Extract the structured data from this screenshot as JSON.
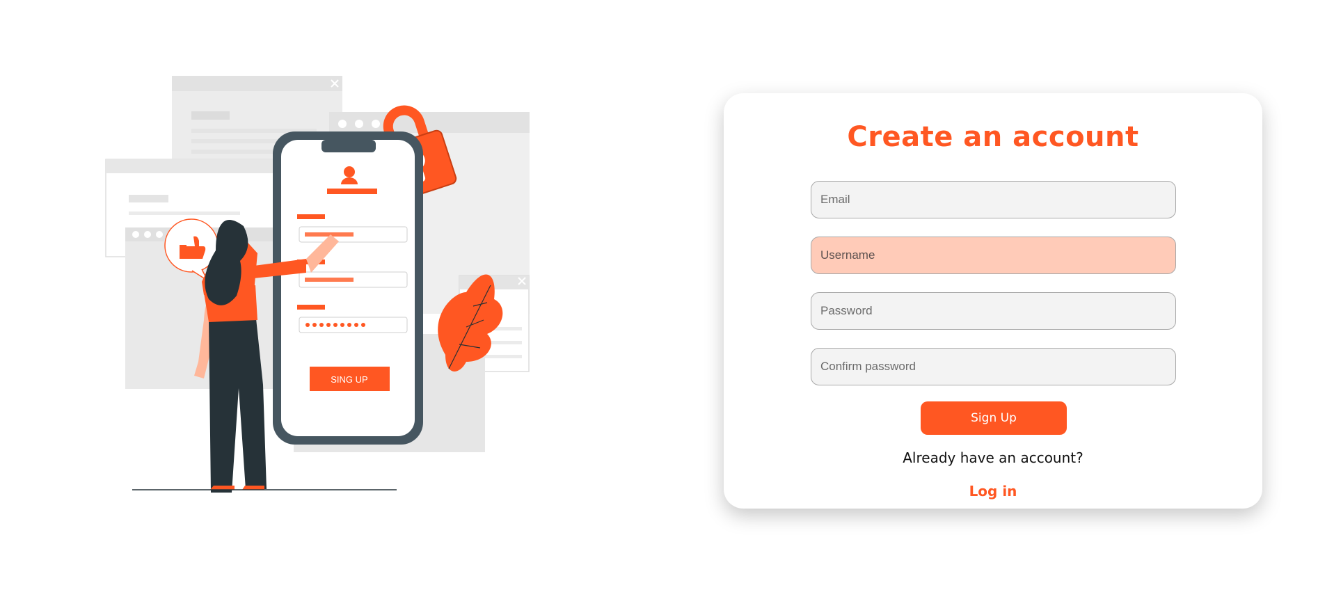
{
  "colors": {
    "accent": "#ff5722",
    "field_bg": "#f3f3f3",
    "field_active_bg": "#ffcbb8"
  },
  "illustration": {
    "description_icon": "signup-illustration-icon",
    "phone_button_label": "SING UP"
  },
  "form": {
    "title": "Create an account",
    "email_placeholder": "Email",
    "username_placeholder": "Username",
    "password_placeholder": "Password",
    "confirm_password_placeholder": "Confirm password",
    "signup_label": "Sign Up",
    "login_prompt": "Already have an account?",
    "login_label": "Log in",
    "focused_field": "username"
  }
}
